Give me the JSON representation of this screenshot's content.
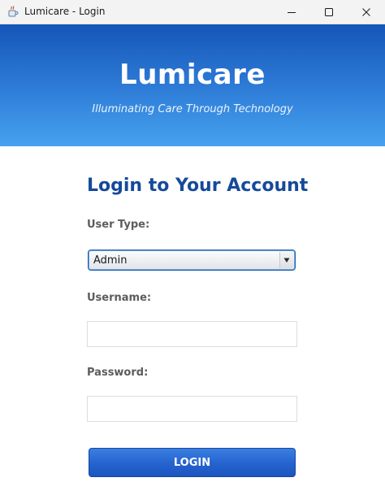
{
  "window": {
    "title": "Lumicare - Login",
    "app_icon": "java-coffee-icon",
    "controls": [
      "minimize-icon",
      "maximize-icon",
      "close-icon"
    ]
  },
  "header": {
    "brand": "Lumicare",
    "tagline": "Illuminating Care Through Technology"
  },
  "form": {
    "title": "Login to Your Account",
    "user_type": {
      "label": "User Type:",
      "selected": "Admin"
    },
    "username": {
      "label": "Username:",
      "value": ""
    },
    "password": {
      "label": "Password:",
      "value": ""
    },
    "login_label": "LOGIN"
  },
  "colors": {
    "header_top": "#1556b8",
    "header_bottom": "#46a2ef",
    "title_blue": "#154a9a",
    "button_blue": "#2563cf",
    "label_gray": "#5c5c5c"
  }
}
